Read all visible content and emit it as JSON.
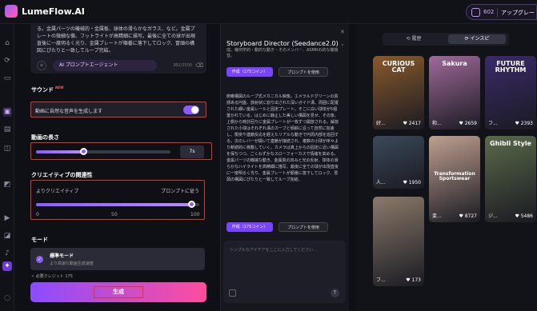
{
  "app": {
    "name": "LumeFlow.AI"
  },
  "header": {
    "credits": "602",
    "upgrade_label": "アップグレー"
  },
  "prompt": {
    "text": "る。金属パーツの機械的・金属板、球体の滑らかなガラス、など。金属プレートの微細な傷、フットライトが高精細に描写。最後に全ての球が出現直後に一度明るく光り、金属プレートが順番に落下してロック、冒頭の構図にぴたりと一致してループ完結。",
    "ai_button": "AI プロンプトエージェント",
    "char_count": "382/2500"
  },
  "sound": {
    "section": "サウンド",
    "new_badge": "NEW",
    "label": "動画に自然な音声を生成します",
    "enabled": true
  },
  "duration": {
    "section": "動画の長さ",
    "value": "7s",
    "fraction": 0.35
  },
  "creativity": {
    "section": "クリエイティブの関連性",
    "left_label": "よりクリエイティブ",
    "right_label": "プロンプトに従う",
    "ticks": [
      "0",
      "50",
      "100"
    ],
    "value": 95
  },
  "mode": {
    "section": "モード",
    "name": "標準モード",
    "desc": "より高速な動画生成速度"
  },
  "required": "必要クレジット 175",
  "generate_label": "生成",
  "storyboard": {
    "title": "Storyboard Director (Seedance2.0)",
    "subtitle": "成。幾何学的・動的な動き・そのメンバー、ASMRの的な機械音。",
    "use_button": "作成（175コイン）",
    "use_prompt": "プロンプトを使用",
    "body": "俯瞰構図のループ式メカニカル映像。エメラルドグリーンの質感ある円盤、放射状に割り出された深いガイド溝、周囲に配置された細い金属レールと固定プレート。そこに白い球体が5個置かれている。はじめに静止した美しい構図を見せ、その後、上側から時計回りに金属プレートが一枚ずつ開放される。解放された小球はそれぞれ溝のカーブと傾斜に沿って自然に加速し、衝突や連鎖反応を経えたリアルな動きで円周内部を巡回する。次のレバーが開いて連鎖が接続され、複数の小球が序々より断続的に移動していく。カメラは真上からの固定に近い構図を保ちつつ、ごくわずかなスローフォーカスで情緒を高める。金属パーツの機械な動き、金属質の凹みと光の反射、球体の滑らかなハイライトを高精細に描写。最後に全ての球が出現直後に一度明るく光り、金属プレートが順番に落下してロック、冒頭の構図にぴたりと一致してループ完結。",
    "use_button2": "作成（175コイン）",
    "use_prompt2": "プロンプトを使用",
    "input_placeholder": "シンプルなアイデアをここに入力してください..."
  },
  "gallery": {
    "tabs": [
      "履歴",
      "インスピ"
    ],
    "cards": [
      {
        "caption": "好...",
        "likes": "2417",
        "overlay": "CURIOUS CAT",
        "color": "#8a5a2c"
      },
      {
        "caption": "和...",
        "likes": "2659",
        "overlay": "Sakura",
        "color": "#a06a9a"
      },
      {
        "caption": "フ...",
        "likes": "2393",
        "overlay": "FUTURE RHYTHM",
        "color": "#3a2a6a"
      },
      {
        "caption": "人...",
        "likes": "1950",
        "overlay": "",
        "color": "#3b4a5a"
      },
      {
        "caption": "変...",
        "likes": "8727",
        "overlay": "Transformation Sportswear",
        "color": "#c0a090"
      },
      {
        "caption": "ジ...",
        "likes": "5486",
        "overlay": "Ghibli Style",
        "color": "#5a6a4a"
      },
      {
        "caption": "フ...",
        "likes": "173",
        "overlay": "",
        "color": "#8a7a6a"
      }
    ]
  }
}
